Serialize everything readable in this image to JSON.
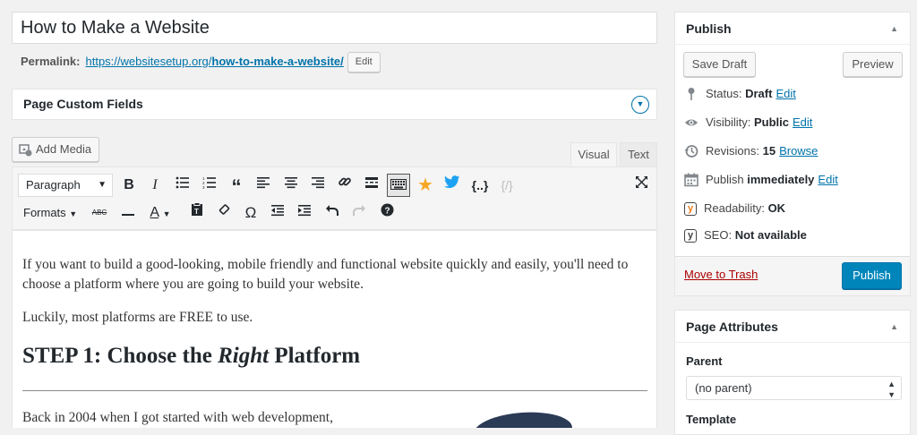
{
  "title": "How to Make a Website",
  "permalink": {
    "label": "Permalink:",
    "url_base": "https://websitesetup.org/",
    "url_slug": "how-to-make-a-website/",
    "edit_label": "Edit"
  },
  "custom_fields": {
    "title": "Page Custom Fields"
  },
  "editor": {
    "add_media_label": "Add Media",
    "tabs": [
      {
        "label": "Visual",
        "active": true
      },
      {
        "label": "Text",
        "active": false
      }
    ],
    "paragraph_select": "Paragraph",
    "formats_label": "Formats",
    "abc_label": "ABC",
    "omega_label": "Ω",
    "code_label": "{..}",
    "paragraph1": "If you want to build a good-looking, mobile friendly and functional website quickly and easily, you'll need to choose a platform where you are going to build your website.",
    "paragraph2": "Luckily, most platforms are FREE to use.",
    "heading_pre": "STEP 1: Choose the ",
    "heading_em": "Right",
    "heading_post": " Platform",
    "paragraph3": "Back in 2004 when I got started with web development,"
  },
  "publish": {
    "title": "Publish",
    "save_draft_label": "Save Draft",
    "preview_label": "Preview",
    "status_label": "Status:",
    "status_value": "Draft",
    "status_edit": "Edit",
    "visibility_label": "Visibility:",
    "visibility_value": "Public",
    "visibility_edit": "Edit",
    "revisions_label": "Revisions:",
    "revisions_value": "15",
    "revisions_browse": "Browse",
    "publish_label": "Publish",
    "publish_value": "immediately",
    "publish_edit": "Edit",
    "readability_label": "Readability:",
    "readability_value": "OK",
    "seo_label": "SEO:",
    "seo_value": "Not available",
    "trash_label": "Move to Trash",
    "publish_button": "Publish"
  },
  "page_attributes": {
    "title": "Page Attributes",
    "parent_label": "Parent",
    "parent_value": "(no parent)",
    "template_label": "Template"
  },
  "colors": {
    "link": "#0073aa",
    "primary_button": "#0085ba",
    "trash": "#a00000",
    "yoast_orange": "#ee7c1b"
  }
}
